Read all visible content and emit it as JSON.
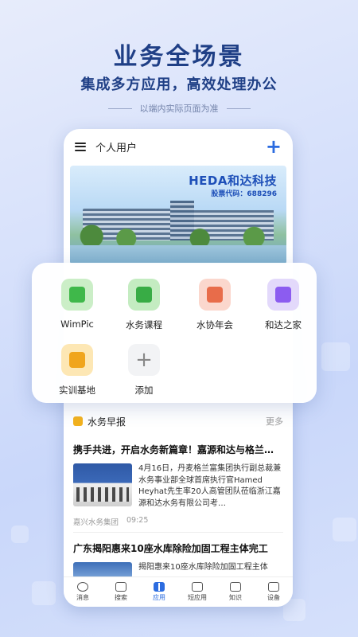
{
  "promo": {
    "headline": "业务全场景",
    "subheadline": "集成多方应用，高效处理办公",
    "note": "以端内实际页面为准"
  },
  "header": {
    "title": "个人用户",
    "menu_icon": "menu-icon",
    "add_icon": "plus-icon"
  },
  "banner": {
    "brand": "HEDA和达科技",
    "stock": "股票代码：688296"
  },
  "apps": [
    {
      "label": "WimPic",
      "icon": "notebook-pen-icon"
    },
    {
      "label": "水务课程",
      "icon": "course-icon"
    },
    {
      "label": "水协年会",
      "icon": "meeting-icon"
    },
    {
      "label": "和达之家",
      "icon": "home-smile-icon"
    },
    {
      "label": "实训基地",
      "icon": "building-icon"
    },
    {
      "label": "添加",
      "icon": "add-icon"
    }
  ],
  "news": {
    "section_title": "水务早报",
    "more": "更多",
    "articles": [
      {
        "title": "携手共进，开启水务新篇章！嘉源和达与格兰…",
        "excerpt": "4月16日，丹麦格兰富集团执行副总裁兼水务事业部全球首席执行官Hamed Heyhat先生率20人高管团队莅临浙江嘉源和达水务有限公司考…",
        "source": "嘉兴水务集团",
        "time": "09:25"
      },
      {
        "title": "广东揭阳惠来10座水库除险加固工程主体完工",
        "excerpt": "揭阳惠来10座水库除险加固工程主体"
      }
    ]
  },
  "tabs": [
    {
      "label": "消息"
    },
    {
      "label": "搜索"
    },
    {
      "label": "应用",
      "active": true
    },
    {
      "label": "短应用"
    },
    {
      "label": "知识"
    },
    {
      "label": "设备"
    }
  ],
  "colors": {
    "accent": "#2c6ce0",
    "headline": "#1f3f86"
  }
}
